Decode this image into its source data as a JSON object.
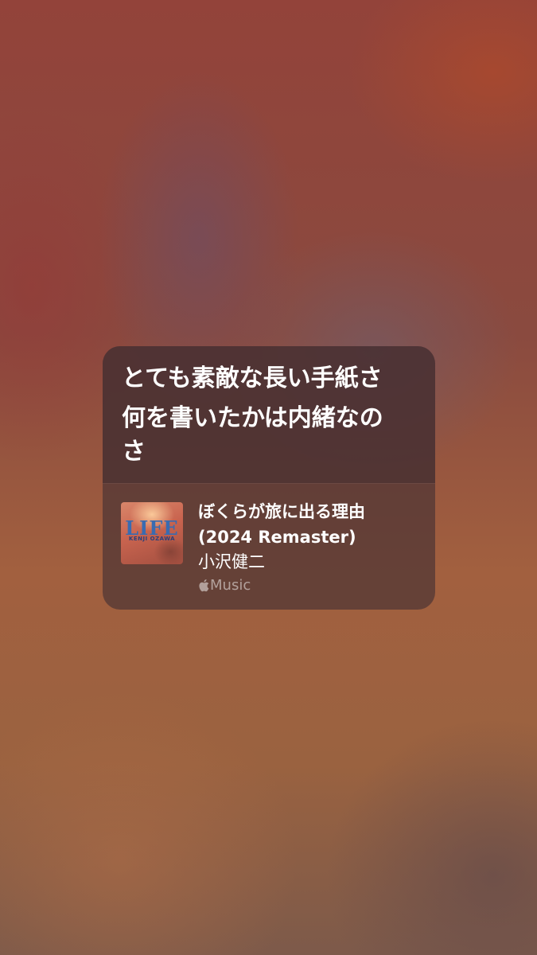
{
  "lyrics": {
    "lines": [
      "とても素敵な長い手紙さ",
      "何を書いたかは内緒なの",
      "さ"
    ]
  },
  "track": {
    "title_line1": "ぼくらが旅に出る理由",
    "title_line2": "(2024 Remaster)",
    "artist": "小沢健二",
    "service": "Music"
  },
  "artwork": {
    "title": "LIFE",
    "subtitle": "KENJI OZAWA"
  },
  "icons": {
    "service_logo": "apple-icon"
  },
  "colors": {
    "card_background": "#4e3434",
    "text_primary": "#ffffff",
    "text_secondary": "#9e8c8c"
  }
}
